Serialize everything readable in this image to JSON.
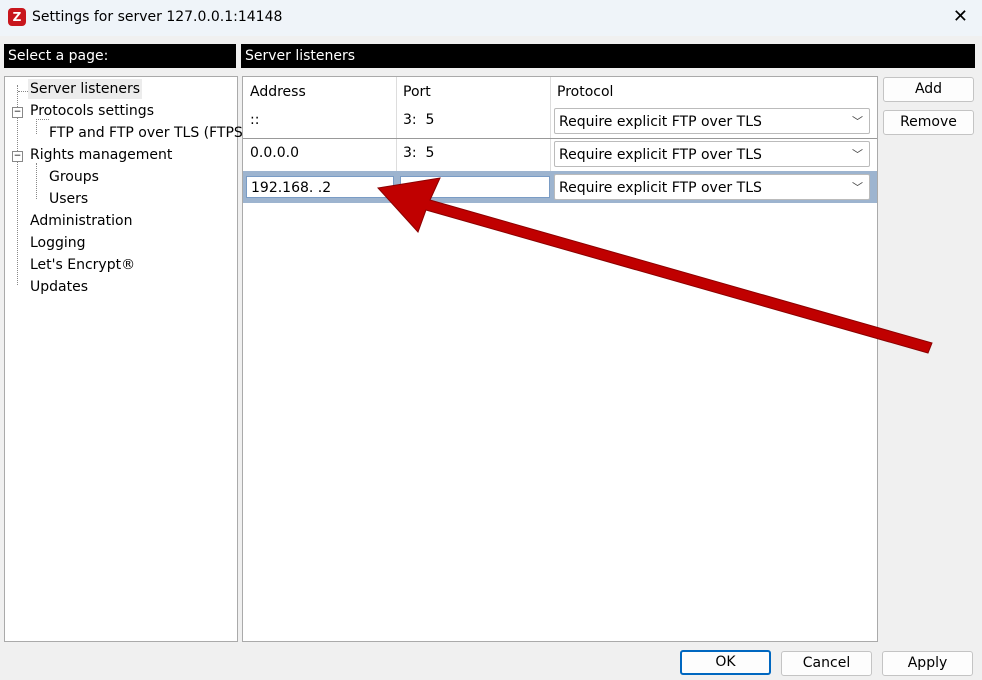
{
  "window": {
    "title": "Settings for server 127.0.0.1:14148"
  },
  "left": {
    "header": "Select a page:",
    "items": [
      {
        "label": "Server listeners"
      },
      {
        "label": "Protocols settings"
      },
      {
        "label": "FTP and FTP over TLS (FTPS)"
      },
      {
        "label": "Rights management"
      },
      {
        "label": "Groups"
      },
      {
        "label": "Users"
      },
      {
        "label": "Administration"
      },
      {
        "label": "Logging"
      },
      {
        "label": "Let's Encrypt®"
      },
      {
        "label": "Updates"
      }
    ]
  },
  "right": {
    "header": "Server listeners",
    "columns": [
      "Address",
      "Port",
      "Protocol"
    ],
    "rows": [
      {
        "address": "::",
        "port": "3:  5",
        "protocol": "Require explicit FTP over TLS"
      },
      {
        "address": "0.0.0.0",
        "port": "3:  5",
        "protocol": "Require explicit FTP over TLS"
      },
      {
        "address": "192.168.  .2",
        "port": "   5",
        "protocol": "Require explicit FTP over TLS"
      }
    ],
    "add": "Add",
    "remove": "Remove"
  },
  "footer": {
    "ok": "OK",
    "cancel": "Cancel",
    "apply": "Apply"
  },
  "annotation": {
    "arrow_color": "#c00000"
  }
}
